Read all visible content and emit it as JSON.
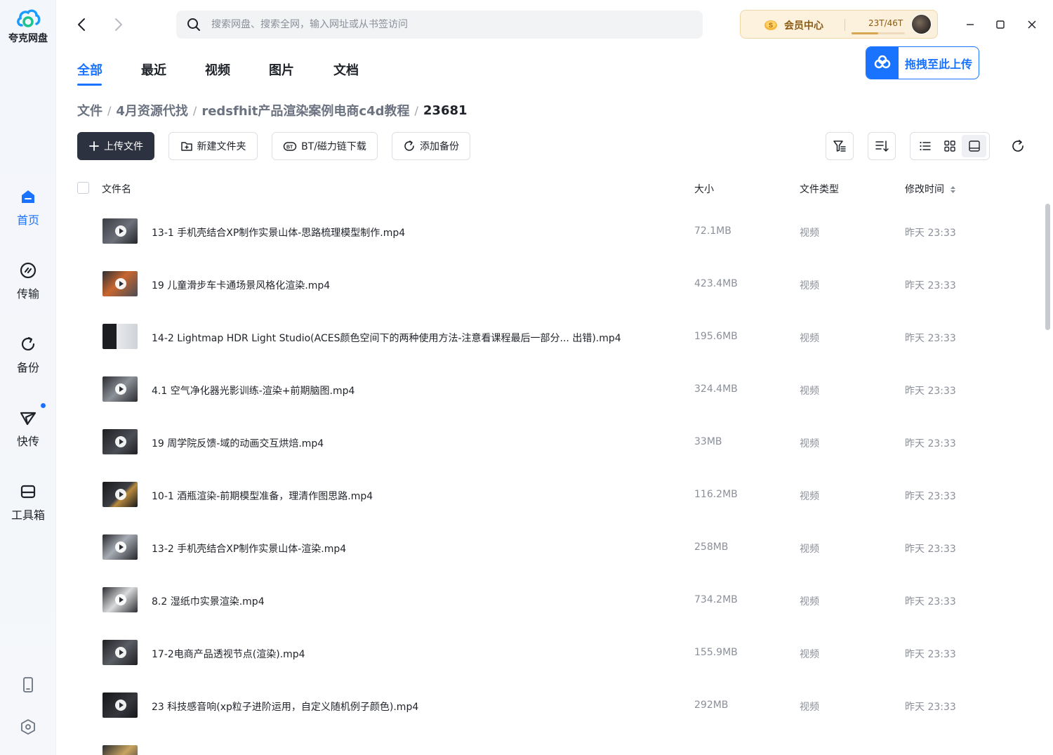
{
  "app": {
    "name": "夸克网盘"
  },
  "sidebar": {
    "items": [
      {
        "label": "首页",
        "icon": "home-icon",
        "active": true
      },
      {
        "label": "传输",
        "icon": "transfer-icon",
        "active": false
      },
      {
        "label": "备份",
        "icon": "backup-icon",
        "active": false
      },
      {
        "label": "快传",
        "icon": "send-icon",
        "active": false,
        "has_badge": true
      },
      {
        "label": "工具箱",
        "icon": "toolbox-icon",
        "active": false
      }
    ],
    "bottom_icons": [
      "phone-icon",
      "settings-icon"
    ]
  },
  "search": {
    "placeholder": "搜索网盘、搜索全网，输入网址或从书签访问"
  },
  "vip": {
    "label": "会员中心",
    "storage": "23T/46T",
    "usage_fraction": 0.5
  },
  "upload_drop": {
    "label": "拖拽至此上传"
  },
  "tabs": [
    {
      "label": "全部",
      "active": true
    },
    {
      "label": "最近",
      "active": false
    },
    {
      "label": "视频",
      "active": false
    },
    {
      "label": "图片",
      "active": false
    },
    {
      "label": "文档",
      "active": false
    }
  ],
  "breadcrumb": [
    "文件",
    "4月资源代找",
    "redsfhit产品渲染案例电商c4d教程",
    "23681"
  ],
  "actions": {
    "upload": "上传文件",
    "new_folder": "新建文件夹",
    "bt": "BT/磁力链下载",
    "backup": "添加备份"
  },
  "table": {
    "headers": {
      "name": "文件名",
      "size": "大小",
      "type": "文件类型",
      "modified": "修改时间"
    },
    "rows": [
      {
        "name": "13-1 手机壳结合XP制作实景山体-思路梳理模型制作.mp4",
        "size": "72.1MB",
        "type": "视频",
        "modified": "昨天 23:33"
      },
      {
        "name": "19 儿童滑步车卡通场景风格化渲染.mp4",
        "size": "423.4MB",
        "type": "视频",
        "modified": "昨天 23:33"
      },
      {
        "name": "14-2 Lightmap HDR Light Studio(ACES颜色空间下的两种使用方法-注意看课程最后一部分...  出错).mp4",
        "size": "195.6MB",
        "type": "视频",
        "modified": "昨天 23:33"
      },
      {
        "name": "4.1 空气净化器光影训练-渲染+前期脑图.mp4",
        "size": "324.4MB",
        "type": "视频",
        "modified": "昨天 23:33"
      },
      {
        "name": "19 周学院反馈-域的动画交互烘焙.mp4",
        "size": "33MB",
        "type": "视频",
        "modified": "昨天 23:33"
      },
      {
        "name": "10-1 酒瓶渲染-前期模型准备，理清作图思路.mp4",
        "size": "116.2MB",
        "type": "视频",
        "modified": "昨天 23:33"
      },
      {
        "name": "13-2 手机壳结合XP制作实景山体-渲染.mp4",
        "size": "258MB",
        "type": "视频",
        "modified": "昨天 23:33"
      },
      {
        "name": "8.2 湿纸巾实景渲染.mp4",
        "size": "734.2MB",
        "type": "视频",
        "modified": "昨天 23:33"
      },
      {
        "name": "17-2电商产品透视节点(渲染).mp4",
        "size": "155.9MB",
        "type": "视频",
        "modified": "昨天 23:33"
      },
      {
        "name": "23 科技感音响(xp粒子进阶运用，自定义随机例子颜色).mp4",
        "size": "292MB",
        "type": "视频",
        "modified": "昨天 23:33"
      }
    ]
  },
  "colors": {
    "accent": "#1a73ff",
    "primary_button": "#2c3240",
    "vip_text": "#8a5a12"
  }
}
